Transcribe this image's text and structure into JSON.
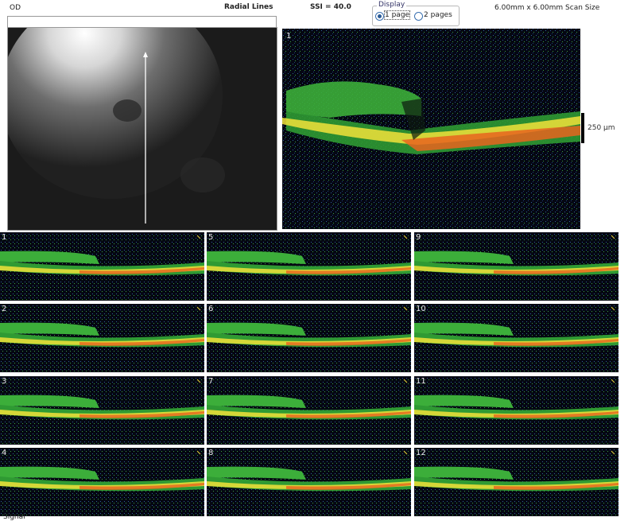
{
  "header": {
    "eye": "OD",
    "scan_type": "Radial Lines",
    "ssi": "SSI = 40.0",
    "scan_size": "6.00mm x 6.00mm Scan Size",
    "display": {
      "legend": "Display",
      "options": [
        {
          "label": "1 page",
          "selected": true
        },
        {
          "label": "2 pages",
          "selected": false
        }
      ]
    }
  },
  "main_scan": {
    "number": "1",
    "scale_label": "250 µm"
  },
  "tiles": [
    "1",
    "2",
    "3",
    "4",
    "5",
    "6",
    "7",
    "8",
    "9",
    "10",
    "11",
    "12"
  ],
  "footer_text": "Signal",
  "colors": {
    "background": "#050712",
    "retina_green": "#36b832",
    "rpe_orange": "#e8641e",
    "rpe_yellow": "#f2e23a"
  }
}
